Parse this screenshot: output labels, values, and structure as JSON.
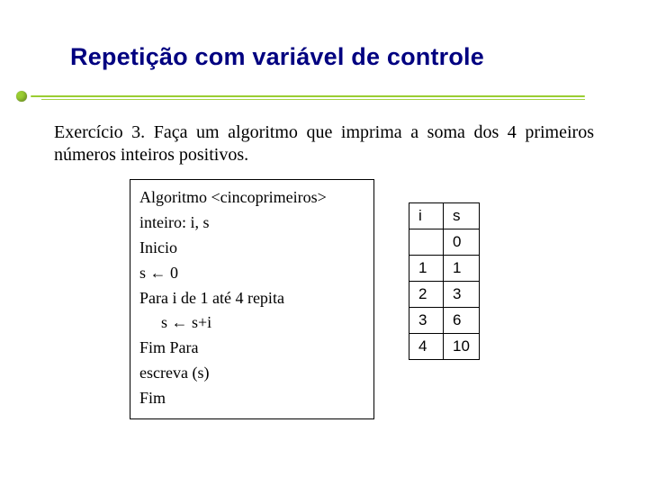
{
  "title": "Repetição com variável de controle",
  "problem": "Exercício 3. Faça um algoritmo que imprima a soma dos 4 primeiros números inteiros positivos.",
  "algorithm": {
    "l1": "Algoritmo <cincoprimeiros>",
    "l2": "inteiro: i, s",
    "l3": "Inicio",
    "l4": "s     ← 0",
    "l5": "Para i de 1 até 4 repita",
    "l6": "s ← s+i",
    "l7": "Fim Para",
    "l8": "escreva (s)",
    "l9": "Fim"
  },
  "trace": {
    "header_i": "i",
    "header_s": "s",
    "rows": [
      {
        "i": "",
        "s": "0"
      },
      {
        "i": "1",
        "s": "1"
      },
      {
        "i": "2",
        "s": "3"
      },
      {
        "i": "3",
        "s": "6"
      },
      {
        "i": "4",
        "s": "10"
      }
    ]
  }
}
